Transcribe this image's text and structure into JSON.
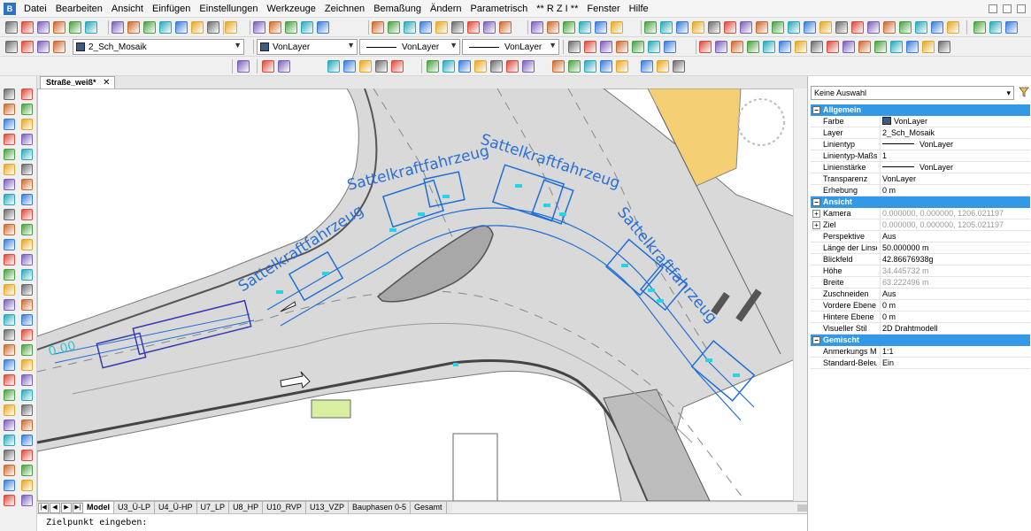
{
  "menubar": {
    "items": [
      "Datei",
      "Bearbeiten",
      "Ansicht",
      "Einfügen",
      "Einstellungen",
      "Werkzeuge",
      "Zeichnen",
      "Bemaßung",
      "Ändern",
      "Parametrisch",
      "** R Z I **",
      "Fenster",
      "Hilfe"
    ]
  },
  "toolbar2": {
    "layer_combo": "2_Sch_Mosaik",
    "color_combo": "VonLayer",
    "linetype_combo": "VonLayer",
    "lineweight_combo": "VonLayer"
  },
  "document_tab": {
    "title": "Straße_weiß*"
  },
  "drawing": {
    "vehicle_labels": [
      "Sattelkraftfahrzeug",
      "Sattelkraftfahrzeug",
      "Sattelkraftfahrzeug",
      "Sattelkraftfahrzeug"
    ],
    "dimension_label": "0.00"
  },
  "layout_tabs": [
    "Model",
    "U3_Ü-LP",
    "U4_Ü-HP",
    "U7_LP",
    "U8_HP",
    "U10_RVP",
    "U13_VZP",
    "Bauphasen 0-5",
    "Gesamt"
  ],
  "command_line": {
    "prompt": "Zielpunkt eingeben:"
  },
  "properties": {
    "selection": "Keine Auswahl",
    "sections": [
      {
        "title": "Allgemein",
        "rows": [
          {
            "label": "Farbe",
            "value": "VonLayer",
            "swatch": true
          },
          {
            "label": "Layer",
            "value": "2_Sch_Mosaik"
          },
          {
            "label": "Linientyp",
            "value": "VonLayer",
            "line": true
          },
          {
            "label": "Linientyp-Maßstab",
            "value": "1"
          },
          {
            "label": "Linienstärke",
            "value": "VonLayer",
            "line": true
          },
          {
            "label": "Transparenz",
            "value": "VonLayer"
          },
          {
            "label": "Erhebung",
            "value": "0 m"
          }
        ]
      },
      {
        "title": "Ansicht",
        "rows": [
          {
            "label": "Kamera",
            "value": "0.000000, 0.000000, 1206.021197",
            "grey": true,
            "expand": true
          },
          {
            "label": "Ziel",
            "value": "0.000000, 0.000000, 1205.021197",
            "grey": true,
            "expand": true
          },
          {
            "label": "Perspektive",
            "value": "Aus"
          },
          {
            "label": "Länge der Linse",
            "value": "50.000000 m"
          },
          {
            "label": "Blickfeld",
            "value": "42.86676938g"
          },
          {
            "label": "Höhe",
            "value": "34.445732 m",
            "grey": true
          },
          {
            "label": "Breite",
            "value": "63.222496 m",
            "grey": true
          },
          {
            "label": "Zuschneiden",
            "value": "Aus"
          },
          {
            "label": "Vordere Ebene",
            "value": "0 m"
          },
          {
            "label": "Hintere Ebene",
            "value": "0 m"
          },
          {
            "label": "Visueller Stil",
            "value": "2D Drahtmodell"
          }
        ]
      },
      {
        "title": "Gemischt",
        "rows": [
          {
            "label": "Anmerkungs Maßstab",
            "value": "1:1"
          },
          {
            "label": "Standard-Beleuchtung",
            "value": "Ein"
          }
        ]
      }
    ]
  }
}
